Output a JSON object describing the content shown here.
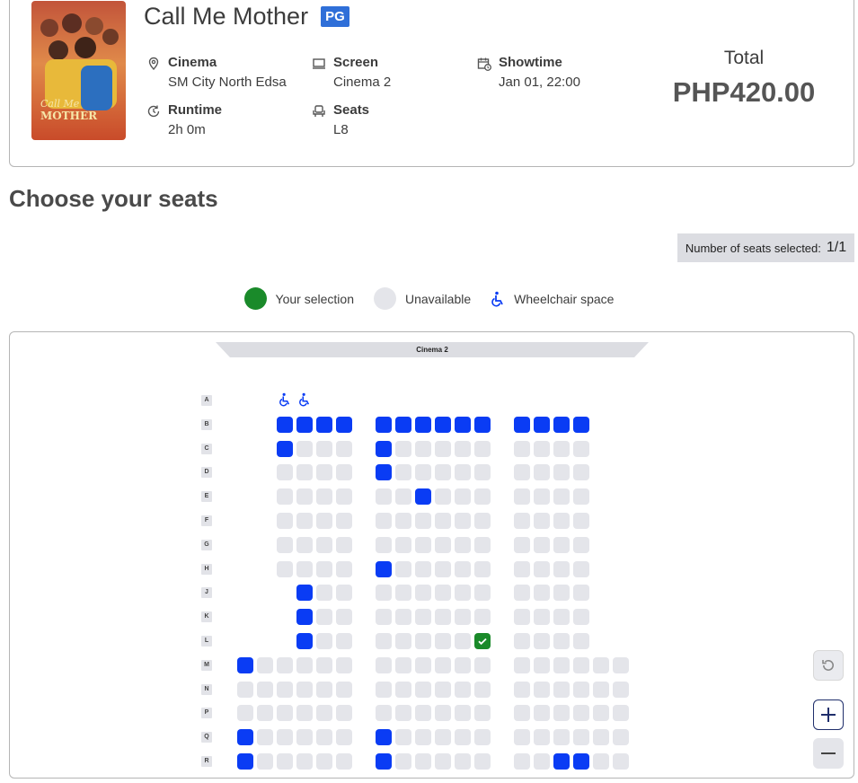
{
  "movie": {
    "title": "Call Me Mother",
    "rating": "PG",
    "cinema_label": "Cinema",
    "cinema_value": "SM City North Edsa",
    "screen_label": "Screen",
    "screen_value": "Cinema 2",
    "showtime_label": "Showtime",
    "showtime_value": "Jan 01, 22:00",
    "runtime_label": "Runtime",
    "runtime_value": "2h 0m",
    "seats_label": "Seats",
    "seats_value": "L8",
    "poster_title": "Call Me MOTHER"
  },
  "total": {
    "label": "Total",
    "value": "PHP420.00"
  },
  "page": {
    "heading": "Choose your seats"
  },
  "selection": {
    "label": "Number of seats selected:",
    "count": "1/1"
  },
  "legend": {
    "selection": "Your selection",
    "unavailable": "Unavailable",
    "wheelchair": "Wheelchair space"
  },
  "seat_map": {
    "screen_label": "Cinema 2",
    "rows": [
      "A",
      "B",
      "C",
      "D",
      "E",
      "F",
      "G",
      "H",
      "J",
      "K",
      "L",
      "M",
      "N",
      "P",
      "Q",
      "R"
    ],
    "blue_seats": {
      "B": [
        3,
        4,
        5,
        6,
        7,
        8,
        9,
        10,
        11,
        12,
        14,
        15,
        16,
        17
      ],
      "C": [
        3,
        7
      ],
      "D": [
        7
      ],
      "E": [
        9
      ],
      "H": [
        7
      ],
      "J": [
        4
      ],
      "K": [
        4
      ],
      "L": [
        4
      ],
      "M": [
        1
      ],
      "Q": [
        1,
        7
      ],
      "R": [
        1,
        7,
        16,
        17
      ]
    },
    "wheelchair_seats": {
      "A": [
        3,
        4
      ]
    },
    "selected_seat": {
      "row": "L",
      "seat": 12
    }
  },
  "colors": {
    "selected": "#1a8a2a",
    "unavailable": "#e4e5ea",
    "wheelchair": "#0a3cf4",
    "rating": "#2f6fd8"
  },
  "controls": {
    "reset_icon": "reset-icon",
    "zoom_in_icon": "plus-icon",
    "zoom_out_icon": "minus-icon"
  }
}
